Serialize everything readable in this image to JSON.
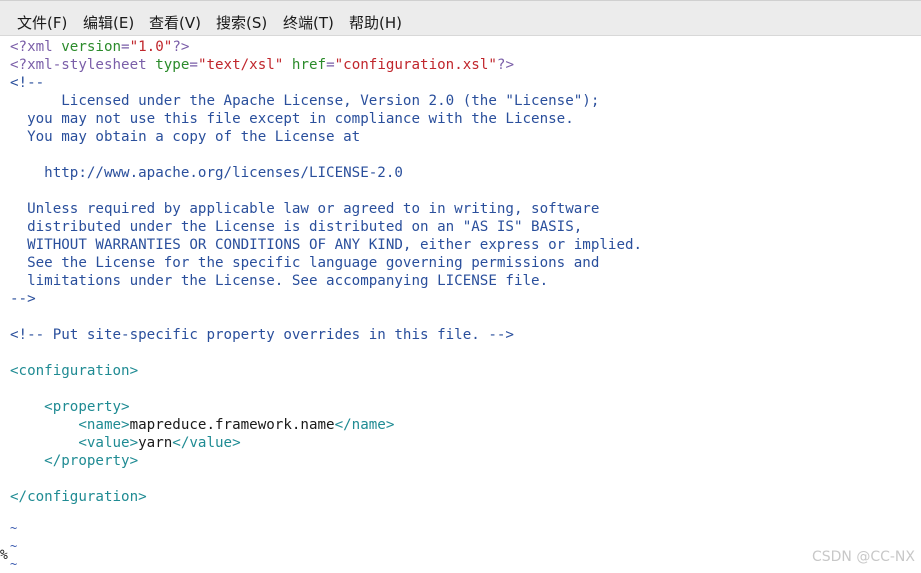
{
  "menu": {
    "file": "文件(F)",
    "edit": "编辑(E)",
    "view": "查看(V)",
    "search": "搜索(S)",
    "terminal": "终端(T)",
    "help": "帮助(H)"
  },
  "editor": {
    "xml_decl": {
      "open": "<?xml ",
      "attr": "version",
      "eq": "=",
      "value": "\"1.0\"",
      "close": "?>"
    },
    "stylesheet_pi": {
      "open": "<?xml-stylesheet ",
      "attr1": "type",
      "eq1": "=",
      "value1": "\"text/xsl\"",
      "space": " ",
      "attr2": "href",
      "eq2": "=",
      "value2": "\"configuration.xsl\"",
      "close": "?>"
    },
    "comment_lines": [
      "<!--",
      "      Licensed under the Apache License, Version 2.0 (the \"License\");",
      "  you may not use this file except in compliance with the License.",
      "  You may obtain a copy of the License at",
      "",
      "    http://www.apache.org/licenses/LICENSE-2.0",
      "",
      "  Unless required by applicable law or agreed to in writing, software",
      "  distributed under the License is distributed on an \"AS IS\" BASIS,",
      "  WITHOUT WARRANTIES OR CONDITIONS OF ANY KIND, either express or implied.",
      "  See the License for the specific language governing permissions and",
      "  limitations under the License. See accompanying LICENSE file.",
      "-->"
    ],
    "site_comment": "<!-- Put site-specific property overrides in this file. -->",
    "configuration_open": "<configuration>",
    "property_open": "    <property>",
    "name_open": "        <name>",
    "name_value": "mapreduce.framework.name",
    "name_close": "</name>",
    "value_open": "        <value>",
    "value_value": "yarn",
    "value_close": "</value>",
    "property_close": "    </property>",
    "configuration_close": "</configuration>",
    "tilde": "~",
    "status_fragment": "%"
  },
  "watermark": "CSDN @CC-NX"
}
